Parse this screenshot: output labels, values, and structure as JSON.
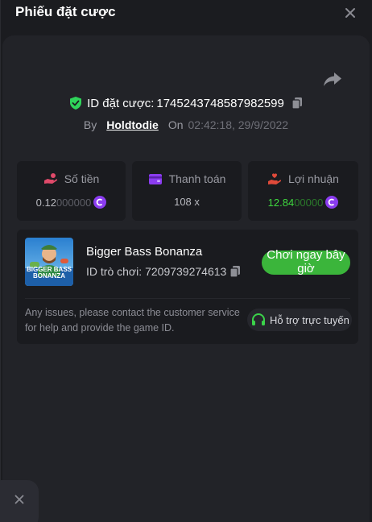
{
  "header": {
    "title": "Phiếu đặt cược"
  },
  "bet": {
    "id_label": "ID đặt cược:",
    "id_value": "1745243748587982599",
    "by_label": "By",
    "username": "Holdtodie",
    "on_label": "On",
    "timestamp": "02:42:18, 29/9/2022"
  },
  "stats": {
    "amount": {
      "label": "Số tiền",
      "value_main": "0.12",
      "value_dim": "000000"
    },
    "payout": {
      "label": "Thanh toán",
      "value": "108 x"
    },
    "profit": {
      "label": "Lợi nhuận",
      "value_main": "12.84",
      "value_dim": "00000"
    }
  },
  "game": {
    "name": "Bigger Bass Bonanza",
    "id_label": "ID trò chơi:",
    "id_value": "7209739274613",
    "thumb_text_1": "BIGGER BASS",
    "thumb_text_2": "BONANZA",
    "play_label": "Chơi ngay bây giờ"
  },
  "support": {
    "message": "Any issues, please contact the customer service for help and provide the game ID.",
    "button_label": "Hỗ trợ trực tuyến"
  },
  "colors": {
    "accent_green": "#3bb53b",
    "coin_purple": "#8b3cf0",
    "shield_green": "#2fd35a"
  },
  "icons": {
    "close": "close-icon",
    "share": "share-icon",
    "shield": "shield-check-icon",
    "copy": "copy-icon",
    "amount": "hand-coin-icon",
    "payout": "wallet-icon",
    "profit": "hand-heart-icon",
    "coin": "coin-icon",
    "headset": "headset-icon"
  }
}
